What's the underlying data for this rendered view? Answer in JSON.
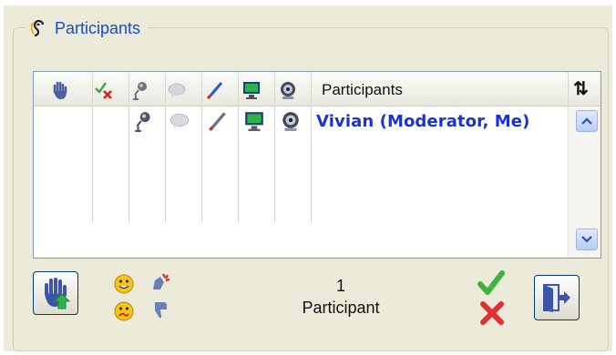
{
  "panel": {
    "title": "Participants"
  },
  "grid": {
    "header": {
      "participants_label": "Participants",
      "sort_glyph": "⇅",
      "icons": [
        "raise-hand-icon",
        "approve-deny-icon",
        "microphone-icon",
        "chat-bubble-icon",
        "pen-icon",
        "desktop-share-icon",
        "webcam-icon"
      ]
    },
    "rows": [
      {
        "name": "Vivian (Moderator, Me)",
        "icons": [
          "microphone-icon",
          "chat-bubble-icon",
          "pen-icon",
          "desktop-share-icon",
          "webcam-icon"
        ]
      }
    ]
  },
  "footer": {
    "count": "1",
    "count_label": "Participant"
  },
  "colors": {
    "accent": "#1a4ac8",
    "name_text": "#1933cc",
    "panel_bg": "#ecead9",
    "button_border": "#003c74"
  }
}
